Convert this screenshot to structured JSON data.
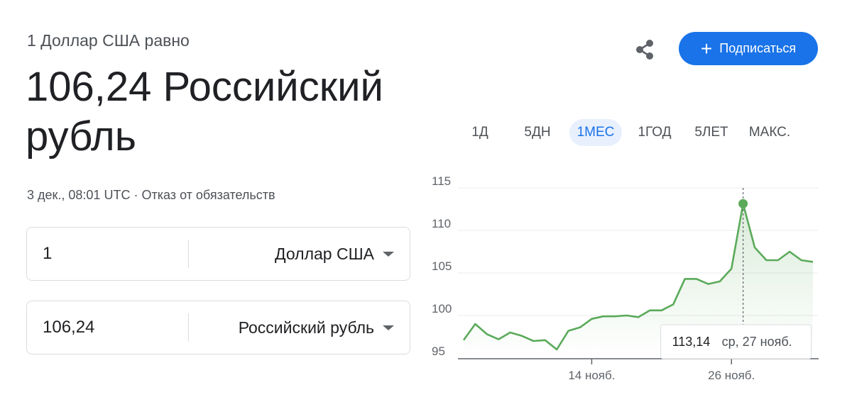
{
  "header": {
    "subtitle": "1 Доллар США равно",
    "value": "106,24 Российский рубль",
    "timestamp": "3 дек., 08:01 UTC",
    "separator": "·",
    "disclaimer": "Отказ от обязательств"
  },
  "actions": {
    "share_icon": "share-icon",
    "subscribe_label": "Подписаться",
    "subscribe_icon": "plus-icon"
  },
  "converter": {
    "from": {
      "amount": "1",
      "currency": "Доллар США"
    },
    "to": {
      "amount": "106,24",
      "currency": "Российский рубль"
    }
  },
  "ranges": [
    "1Д",
    "5ДН",
    "1МЕС",
    "1ГОД",
    "5ЛЕТ",
    "МАКС."
  ],
  "active_range": "1МЕС",
  "colors": {
    "line": "#5aaa5a",
    "accent": "#1a73e8"
  },
  "chart_data": {
    "type": "line",
    "x": [
      3,
      4,
      5,
      6,
      7,
      8,
      9,
      10,
      11,
      12,
      13,
      14,
      15,
      16,
      17,
      18,
      19,
      20,
      21,
      22,
      23,
      24,
      25,
      26,
      27,
      28,
      29,
      30,
      31,
      32
    ],
    "series": [
      {
        "values": [
          97.1,
          99.0,
          97.8,
          97.2,
          98.0,
          97.6,
          97.0,
          97.1,
          96.0,
          98.2,
          98.6,
          99.6,
          99.9,
          99.9,
          100.0,
          99.8,
          100.6,
          100.6,
          101.3,
          104.3,
          104.3,
          103.7,
          104.0,
          105.5,
          113.14,
          108.0,
          106.5,
          106.5,
          107.5,
          106.5,
          106.3
        ]
      }
    ],
    "x_ticks": [
      "14 нояб.",
      "26 нояб."
    ],
    "y_ticks": [
      "95",
      "100",
      "105",
      "110",
      "115"
    ],
    "ylim": [
      95,
      115
    ],
    "tooltip": {
      "value": "113,14",
      "date": "ср, 27 нояб."
    }
  }
}
